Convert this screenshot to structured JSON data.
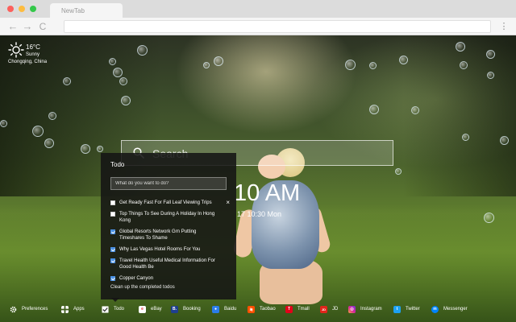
{
  "browser": {
    "tab_title": "NewTab",
    "nav": {
      "back": "←",
      "forward": "→",
      "reload": "C",
      "menu": "⋮"
    }
  },
  "weather": {
    "temperature": "16°C",
    "condition": "Sunny",
    "location": "Chongqing, China",
    "icon": "sun-icon"
  },
  "search": {
    "placeholder": "Search"
  },
  "clock": {
    "time": "10 AM",
    "date": "17 10:30 Mon"
  },
  "todo": {
    "title": "Todo",
    "input_placeholder": "What do you want to do?",
    "items": [
      {
        "text": "Get Ready Fast For Fall Leaf Viewing Trips",
        "done": false
      },
      {
        "text": "Top Things To See During A Holiday In Hong Kong",
        "done": false
      },
      {
        "text": "Global Resorts Network Grn Putting Timeshares To Shame",
        "done": true
      },
      {
        "text": "Why Las Vegas Hotel Rooms For You",
        "done": true
      },
      {
        "text": "Travel Health Useful Medical Information For Good Health Be",
        "done": true
      },
      {
        "text": "Copper Canyon",
        "done": true
      }
    ],
    "delete_glyph": "×",
    "clear_label": "Clean up the completed todos"
  },
  "bottom_bar": {
    "items": [
      {
        "label": "Preferences",
        "icon": "gear-icon",
        "color": "#ffffff"
      },
      {
        "label": "Apps",
        "icon": "grid-icon",
        "color": "#ffffff"
      },
      {
        "label": "Todo",
        "icon": "checkbox-icon",
        "color": "#ffffff"
      },
      {
        "label": "eBay",
        "icon": "ebay-icon",
        "color": "#ffffff"
      },
      {
        "label": "Booking",
        "icon": "booking-icon",
        "color": "#1f3f8f"
      },
      {
        "label": "Baidu",
        "icon": "baidu-icon",
        "color": "#2b7de9"
      },
      {
        "label": "Taobao",
        "icon": "taobao-icon",
        "color": "#ff5000"
      },
      {
        "label": "Tmall",
        "icon": "tmall-icon",
        "color": "#e4001a"
      },
      {
        "label": "JD",
        "icon": "jd-icon",
        "color": "#e1251b"
      },
      {
        "label": "Instagram",
        "icon": "instagram-icon",
        "color": "#d6249f"
      },
      {
        "label": "Twitter",
        "icon": "twitter-icon",
        "color": "#1da1f2"
      },
      {
        "label": "Messenger",
        "icon": "messenger-icon",
        "color": "#0084ff"
      }
    ]
  }
}
